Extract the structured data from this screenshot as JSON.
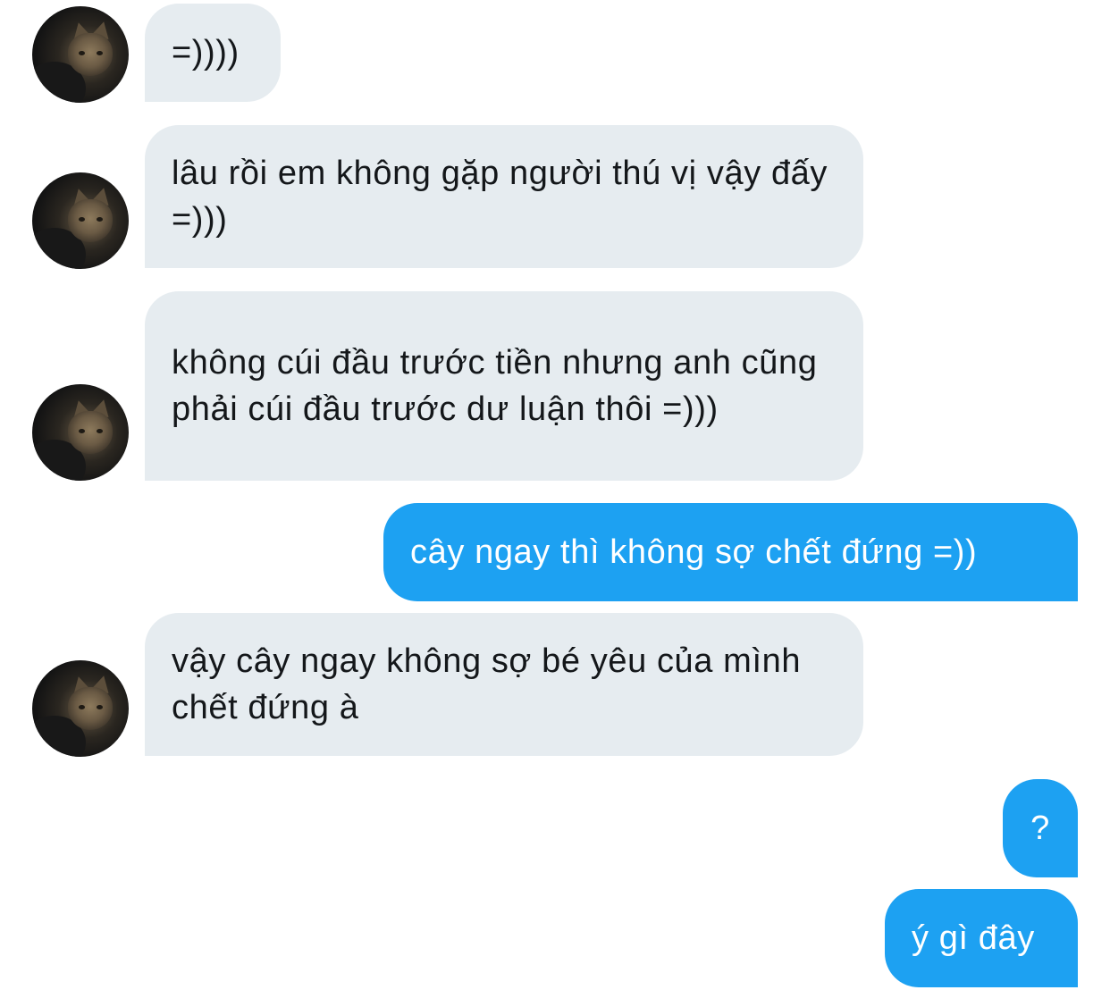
{
  "conversation": {
    "messages": [
      {
        "sender": "them",
        "text": "=))))"
      },
      {
        "sender": "them",
        "text": "lâu rồi em không gặp người thú vị vậy đấy =)))"
      },
      {
        "sender": "them",
        "text": "không cúi đầu trước tiền nhưng anh cũng phải cúi đầu trước dư luận thôi =)))"
      },
      {
        "sender": "me",
        "text": "cây ngay thì không sợ chết đứng =))"
      },
      {
        "sender": "them",
        "text": "vậy cây ngay không sợ bé yêu của mình chết đứng à"
      },
      {
        "sender": "me",
        "text": "?"
      },
      {
        "sender": "me",
        "text": "ý gì đây"
      }
    ]
  },
  "colors": {
    "incoming_bubble": "#e6ecf0",
    "incoming_text": "#14171a",
    "outgoing_bubble": "#1da1f2",
    "outgoing_text": "#ffffff",
    "background": "#ffffff"
  },
  "icons": {
    "avatar": "cat-photo-avatar"
  }
}
